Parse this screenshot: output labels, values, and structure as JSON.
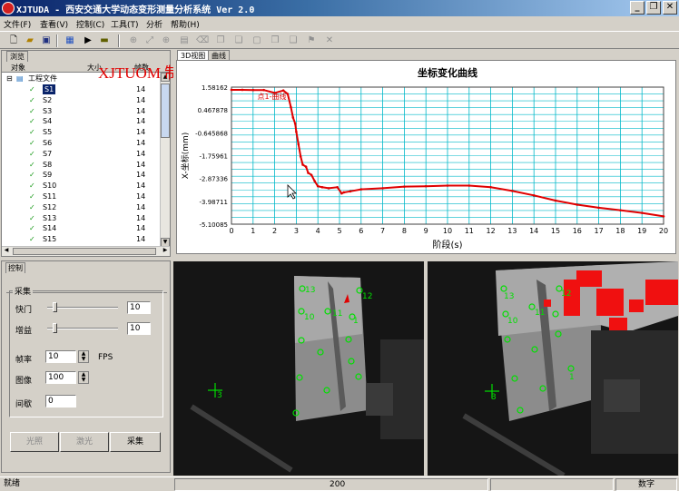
{
  "window": {
    "title": "XJTUDA - 西安交通大学动态变形测量分析系统 Ver 2.0",
    "buttons": [
      "_",
      "❐",
      "✕"
    ]
  },
  "menu": [
    "文件(F)",
    "查看(V)",
    "控制(C)",
    "工具(T)",
    "分析",
    "帮助(H)"
  ],
  "watermark": "XJTUOM 制作",
  "browser": {
    "tab": "浏览",
    "columns": [
      "对象",
      "大小",
      "帧数"
    ],
    "root_label": "工程文件",
    "items": [
      {
        "name": "S1",
        "value": "14"
      },
      {
        "name": "S2",
        "value": "14"
      },
      {
        "name": "S3",
        "value": "14"
      },
      {
        "name": "S4",
        "value": "14"
      },
      {
        "name": "S5",
        "value": "14"
      },
      {
        "name": "S6",
        "value": "14"
      },
      {
        "name": "S7",
        "value": "14"
      },
      {
        "name": "S8",
        "value": "14"
      },
      {
        "name": "S9",
        "value": "14"
      },
      {
        "name": "S10",
        "value": "14"
      },
      {
        "name": "S11",
        "value": "14"
      },
      {
        "name": "S12",
        "value": "14"
      },
      {
        "name": "S13",
        "value": "14"
      },
      {
        "name": "S14",
        "value": "14"
      },
      {
        "name": "S15",
        "value": "14"
      }
    ]
  },
  "view_tabs": [
    "3D视图",
    "曲线"
  ],
  "chart_data": {
    "type": "line",
    "title": "坐标变化曲线",
    "xlabel": "阶段(s)",
    "ylabel": "X-坐标(mm)",
    "xlim": [
      0,
      20
    ],
    "ylim": [
      -5.10085,
      1.58162
    ],
    "xticks": [
      "0",
      "1",
      "2",
      "3",
      "4",
      "5",
      "6",
      "7",
      "8",
      "9",
      "10",
      "11",
      "12",
      "13",
      "14",
      "15",
      "16",
      "17",
      "18",
      "19",
      "20"
    ],
    "yticks": [
      "1.58162",
      "0.467878",
      "-0.645868",
      "-1.75961",
      "-2.87336",
      "-3.98711",
      "-5.10085"
    ],
    "grid": true,
    "annotation": "点1-曲线",
    "color": "#e00000",
    "x": [
      0,
      0.5,
      1.0,
      1.5,
      2.0,
      2.4,
      2.6,
      2.75,
      2.85,
      2.95,
      3.0,
      3.1,
      3.2,
      3.3,
      3.45,
      3.55,
      3.7,
      3.85,
      4.0,
      4.2,
      4.5,
      4.9,
      5.1,
      5.2,
      5.5,
      6.0,
      7.0,
      8.0,
      9.0,
      10.0,
      11.0,
      12.0,
      13.0,
      14.0,
      15.0,
      16.0,
      17.0,
      18.0,
      19.0,
      20.0
    ],
    "y": [
      1.45,
      1.45,
      1.44,
      1.44,
      1.3,
      1.42,
      1.25,
      0.6,
      0.1,
      -0.2,
      -0.6,
      -1.2,
      -1.8,
      -2.2,
      -2.3,
      -2.6,
      -2.7,
      -3.0,
      -3.25,
      -3.3,
      -3.35,
      -3.3,
      -3.6,
      -3.55,
      -3.5,
      -3.4,
      -3.35,
      -3.27,
      -3.25,
      -3.22,
      -3.22,
      -3.3,
      -3.48,
      -3.7,
      -3.95,
      -4.15,
      -4.3,
      -4.42,
      -4.55,
      -4.72
    ]
  },
  "control": {
    "tab": "控制",
    "group_label": "采集",
    "shutter_label": "快门",
    "shutter_value": "10",
    "shutter_level": 0.1,
    "gain_label": "增益",
    "gain_value": "10",
    "gain_level": 0.1,
    "framerate_label": "帧率",
    "framerate_value": "10",
    "framerate_unit": "FPS",
    "images_label": "图像",
    "images_value": "100",
    "interval_label": "间歇",
    "interval_value": "0",
    "buttons": [
      "光照",
      "激光",
      "采集"
    ]
  },
  "cameras": {
    "left_markers": [
      "13",
      "12",
      "10",
      "11",
      "1",
      "3"
    ],
    "right_markers": [
      "13",
      "11",
      "10",
      "12",
      "1",
      "3"
    ]
  },
  "status": {
    "ready": "就绪",
    "center": "200",
    "mode": "数字"
  }
}
